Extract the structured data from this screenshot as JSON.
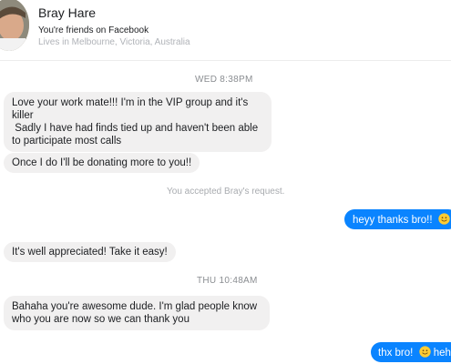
{
  "contact": {
    "name": "Bray Hare",
    "friend_status": "You're friends on Facebook",
    "location": "Lives in Melbourne, Victoria, Australia"
  },
  "conversation": {
    "timestamp_1": "WED 8:38PM",
    "msg_1_line_1": "Love your work mate!!! I'm in the VIP group and it's",
    "msg_1_line_2": "killer",
    "msg_1_line_3": " Sadly I have had finds tied up and haven't been able",
    "msg_1_line_4": "to participate most calls",
    "msg_2": "Once I do I'll be donating more to you!!",
    "system_notice": "You accepted Bray's request.",
    "msg_3": "heyy thanks bro!!",
    "msg_4": "It's well appreciated! Take it easy!",
    "timestamp_2": "THU 10:48AM",
    "msg_5_line_1": "Bahaha you're awesome dude. I'm glad people know",
    "msg_5_line_2": "who you are now so we can thank you",
    "msg_6_before": "thx bro!",
    "msg_6_after": "hehe"
  },
  "icons": {
    "avatar": "profile-photo",
    "emoji": "slightly-smiling-face"
  },
  "colors": {
    "outgoing_bubble": "#0a84ff",
    "incoming_bubble": "#f1f0f0"
  }
}
